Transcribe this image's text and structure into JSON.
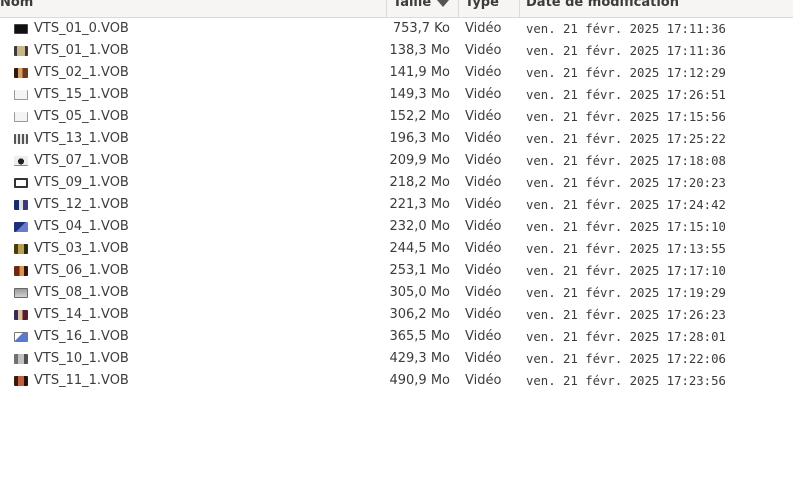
{
  "columns": {
    "name": "Nom",
    "size": "Taille",
    "type": "Type",
    "date": "Date de modification",
    "sort_column": "size",
    "sort_direction": "descending-indicator"
  },
  "files": [
    {
      "name": "VTS_01_0.VOB",
      "size": "753,7 Ko",
      "type": "Vidéo",
      "date": "ven. 21 févr. 2025 17:11:36",
      "thumb": "black"
    },
    {
      "name": "VTS_01_1.VOB",
      "size": "138,3 Mo",
      "type": "Vidéo",
      "date": "ven. 21 févr. 2025 17:11:36",
      "thumb": "film"
    },
    {
      "name": "VTS_02_1.VOB",
      "size": "141,9 Mo",
      "type": "Vidéo",
      "date": "ven. 21 févr. 2025 17:12:29",
      "thumb": "warm"
    },
    {
      "name": "VTS_15_1.VOB",
      "size": "149,3 Mo",
      "type": "Vidéo",
      "date": "ven. 21 févr. 2025 17:26:51",
      "thumb": "white"
    },
    {
      "name": "VTS_05_1.VOB",
      "size": "152,2 Mo",
      "type": "Vidéo",
      "date": "ven. 21 févr. 2025 17:15:56",
      "thumb": "white"
    },
    {
      "name": "VTS_13_1.VOB",
      "size": "196,3 Mo",
      "type": "Vidéo",
      "date": "ven. 21 févr. 2025 17:25:22",
      "thumb": "teeth"
    },
    {
      "name": "VTS_07_1.VOB",
      "size": "209,9 Mo",
      "type": "Vidéo",
      "date": "ven. 21 févr. 2025 17:18:08",
      "thumb": "dot"
    },
    {
      "name": "VTS_09_1.VOB",
      "size": "218,2 Mo",
      "type": "Vidéo",
      "date": "ven. 21 févr. 2025 17:20:23",
      "thumb": "frame"
    },
    {
      "name": "VTS_12_1.VOB",
      "size": "221,3 Mo",
      "type": "Vidéo",
      "date": "ven. 21 févr. 2025 17:24:42",
      "thumb": "blue"
    },
    {
      "name": "VTS_04_1.VOB",
      "size": "232,0 Mo",
      "type": "Vidéo",
      "date": "ven. 21 févr. 2025 17:15:10",
      "thumb": "bluescreen"
    },
    {
      "name": "VTS_03_1.VOB",
      "size": "244,5 Mo",
      "type": "Vidéo",
      "date": "ven. 21 févr. 2025 17:13:55",
      "thumb": "olive"
    },
    {
      "name": "VTS_06_1.VOB",
      "size": "253,1 Mo",
      "type": "Vidéo",
      "date": "ven. 21 févr. 2025 17:17:10",
      "thumb": "rust"
    },
    {
      "name": "VTS_08_1.VOB",
      "size": "305,0 Mo",
      "type": "Vidéo",
      "date": "ven. 21 févr. 2025 17:19:29",
      "thumb": "grey"
    },
    {
      "name": "VTS_14_1.VOB",
      "size": "306,2 Mo",
      "type": "Vidéo",
      "date": "ven. 21 févr. 2025 17:26:23",
      "thumb": "purple"
    },
    {
      "name": "VTS_16_1.VOB",
      "size": "365,5 Mo",
      "type": "Vidéo",
      "date": "ven. 21 févr. 2025 17:28:01",
      "thumb": "sky"
    },
    {
      "name": "VTS_10_1.VOB",
      "size": "429,3 Mo",
      "type": "Vidéo",
      "date": "ven. 21 févr. 2025 17:22:06",
      "thumb": "steel"
    },
    {
      "name": "VTS_11_1.VOB",
      "size": "490,9 Mo",
      "type": "Vidéo",
      "date": "ven. 21 févr. 2025 17:23:56",
      "thumb": "brown"
    }
  ]
}
